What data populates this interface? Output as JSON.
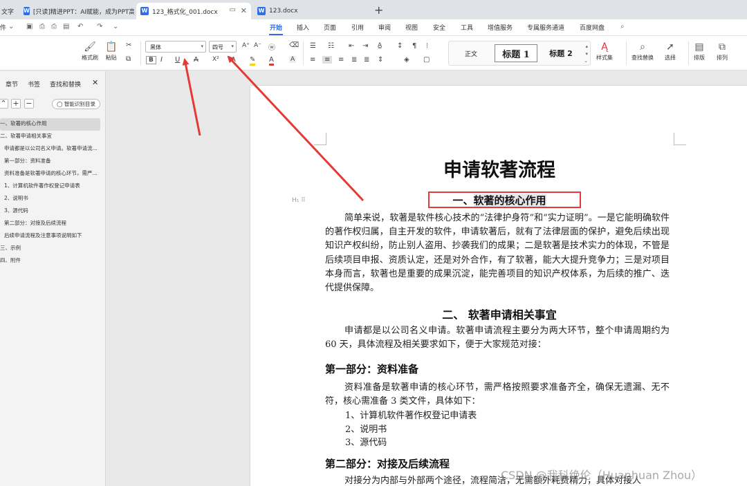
{
  "tabbar": {
    "tab0": "文字",
    "tab1": "[只读]精进PPT：AI赋能，成为PPT高手",
    "tab2": "123_格式化_001.docx",
    "tab3": "123.docx",
    "new_tab": "+"
  },
  "menubar": {
    "file_label": "件",
    "items": [
      "开始",
      "插入",
      "页面",
      "引用",
      "审阅",
      "视图",
      "安全",
      "工具",
      "增值服务",
      "专属服务通道",
      "百度网盘"
    ]
  },
  "ribbon": {
    "format_painter": "格式刷",
    "paste": "粘贴",
    "font_name": "黑体",
    "font_size": "四号",
    "style_normal": "正文",
    "style_h1": "标题 1",
    "style_h2": "标题 2",
    "style_set": "样式集",
    "find_replace": "查找替换",
    "select": "选择",
    "layout": "排版",
    "arrange": "排列"
  },
  "sidepanel": {
    "tabs": [
      "章节",
      "书签",
      "查找和替换"
    ],
    "smart_toc": "智能识别目录",
    "outline": [
      "一、软著的核心作用",
      "二、软著申请相关事宜",
      "申请都是以公司名义申请。软著申请流程主要分为两大环节",
      "第一部分：资料准备",
      "资料准备是软著申请的核心环节，需严格按照要求准备齐全",
      "1、计算机软件著作权登记申请表",
      "2、说明书",
      "3、源代码",
      "第二部分：对接及后续流程",
      "后续申请流程及注意事项说明如下",
      "三、示例",
      "四、附件"
    ]
  },
  "document": {
    "title": "申请软著流程",
    "h1_a_prefix": "一、",
    "h1_a_text": "软著的核心作用",
    "para1": "简单来说，软著是软件核心技术的“法律护身符”和“实力证明”。一是它能明确软件的著作权归属，自主开发的软件，申请软著后，就有了法律层面的保护，避免后续出现知识产权纠纷，防止别人盗用、抄袭我们的成果；二是软著是技术实力的体现，不管是后续项目申报、资质认定，还是对外合作，有了软著，能大大提升竞争力；三是对项目本身而言，软著也是重要的成果沉淀，能完善项目的知识产权体系，为后续的推广、迭代提供保障。",
    "h1_b": "二、  软著申请相关事宜",
    "para2": "申请都是以公司名义申请。软著申请流程主要分为两大环节，整个申请周期约为 60 天，具体流程及相关要求如下，便于大家规范对接：",
    "h2_a": "第一部分：资料准备",
    "para3": "资料准备是软著申请的核心环节，需严格按照要求准备齐全，确保无遗漏、无不符，核心需准备 3 类文件，具体如下：",
    "list": [
      "1、计算机软件著作权登记申请表",
      "2、说明书",
      "3、源代码"
    ],
    "h2_b": "第二部分：对接及后续流程",
    "para4": "对接分为内部与外部两个途径，流程简洁，无需额外耗费精力，具体对接人"
  },
  "watermark": "CSDN @我科绝伦（Huanhuan Zhou）",
  "colors": {
    "accent": "#2e6ee6",
    "annotation_red": "#e53935"
  }
}
